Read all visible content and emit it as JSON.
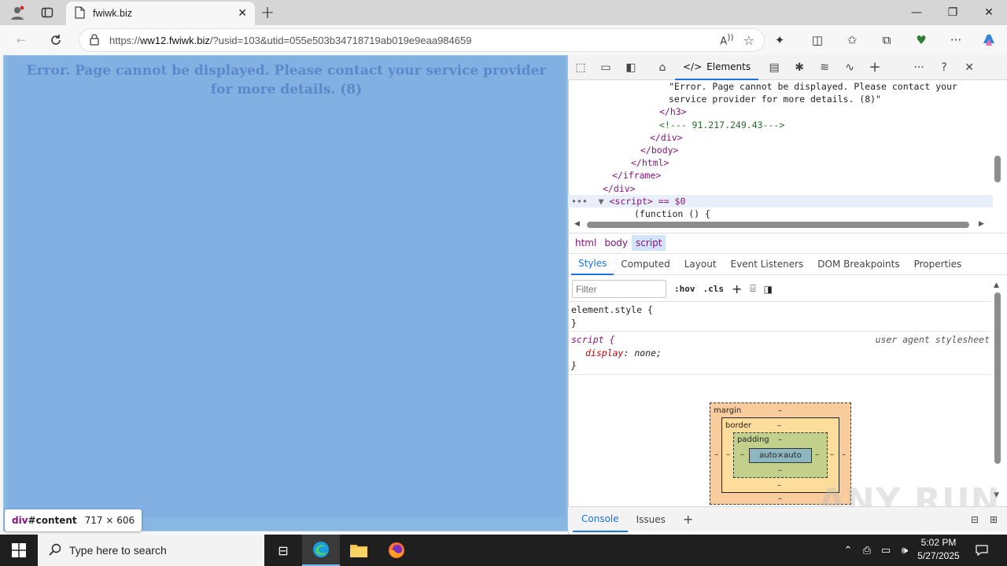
{
  "browser": {
    "tab_title": "fwiwk.biz",
    "url_prefix": "https://",
    "url_host": "ww12.fwiwk.biz",
    "url_path": "/?usid=103&utid=055e503b34718719ab019e9eaa984659"
  },
  "page": {
    "error_message": "Error. Page cannot be displayed. Please contact your service provider for more details. (8)",
    "tooltip_selector_prefix": "div",
    "tooltip_selector_id": "#content",
    "tooltip_size": "717 × 606"
  },
  "devtools": {
    "tab_elements": "Elements",
    "dom_lines": [
      "\"Error. Page cannot be displayed. Please contact your",
      "service provider for more details. (8)\"",
      "</h3>",
      "<!--- 91.217.249.43--->",
      "</div>",
      "</body>",
      "</html>",
      "</iframe>",
      "</div>",
      "<script> == $0",
      "(function () {"
    ],
    "breadcrumbs": [
      "html",
      "body",
      "script"
    ],
    "subtabs": [
      "Styles",
      "Computed",
      "Layout",
      "Event Listeners",
      "DOM Breakpoints",
      "Properties"
    ],
    "filter_placeholder": "Filter",
    "hov": ":hov",
    "cls": ".cls",
    "element_style": "element.style {",
    "close_brace": "}",
    "script_selector": "script {",
    "ua_source": "user agent stylesheet",
    "ua_prop": "display",
    "ua_value": "none;",
    "box_model": {
      "margin": "margin",
      "border": "border",
      "padding": "padding",
      "content": "auto×auto",
      "dash": "–"
    },
    "drawer_tabs": [
      "Console",
      "Issues"
    ],
    "watermark": "ANY RUN"
  },
  "taskbar": {
    "search_placeholder": "Type here to search",
    "time": "5:02 PM",
    "date": "5/27/2025"
  },
  "colors": {
    "page_bg": "#82b0e2",
    "accent": "#1a73e8",
    "tag": "#881280",
    "comment": "#236e25"
  }
}
